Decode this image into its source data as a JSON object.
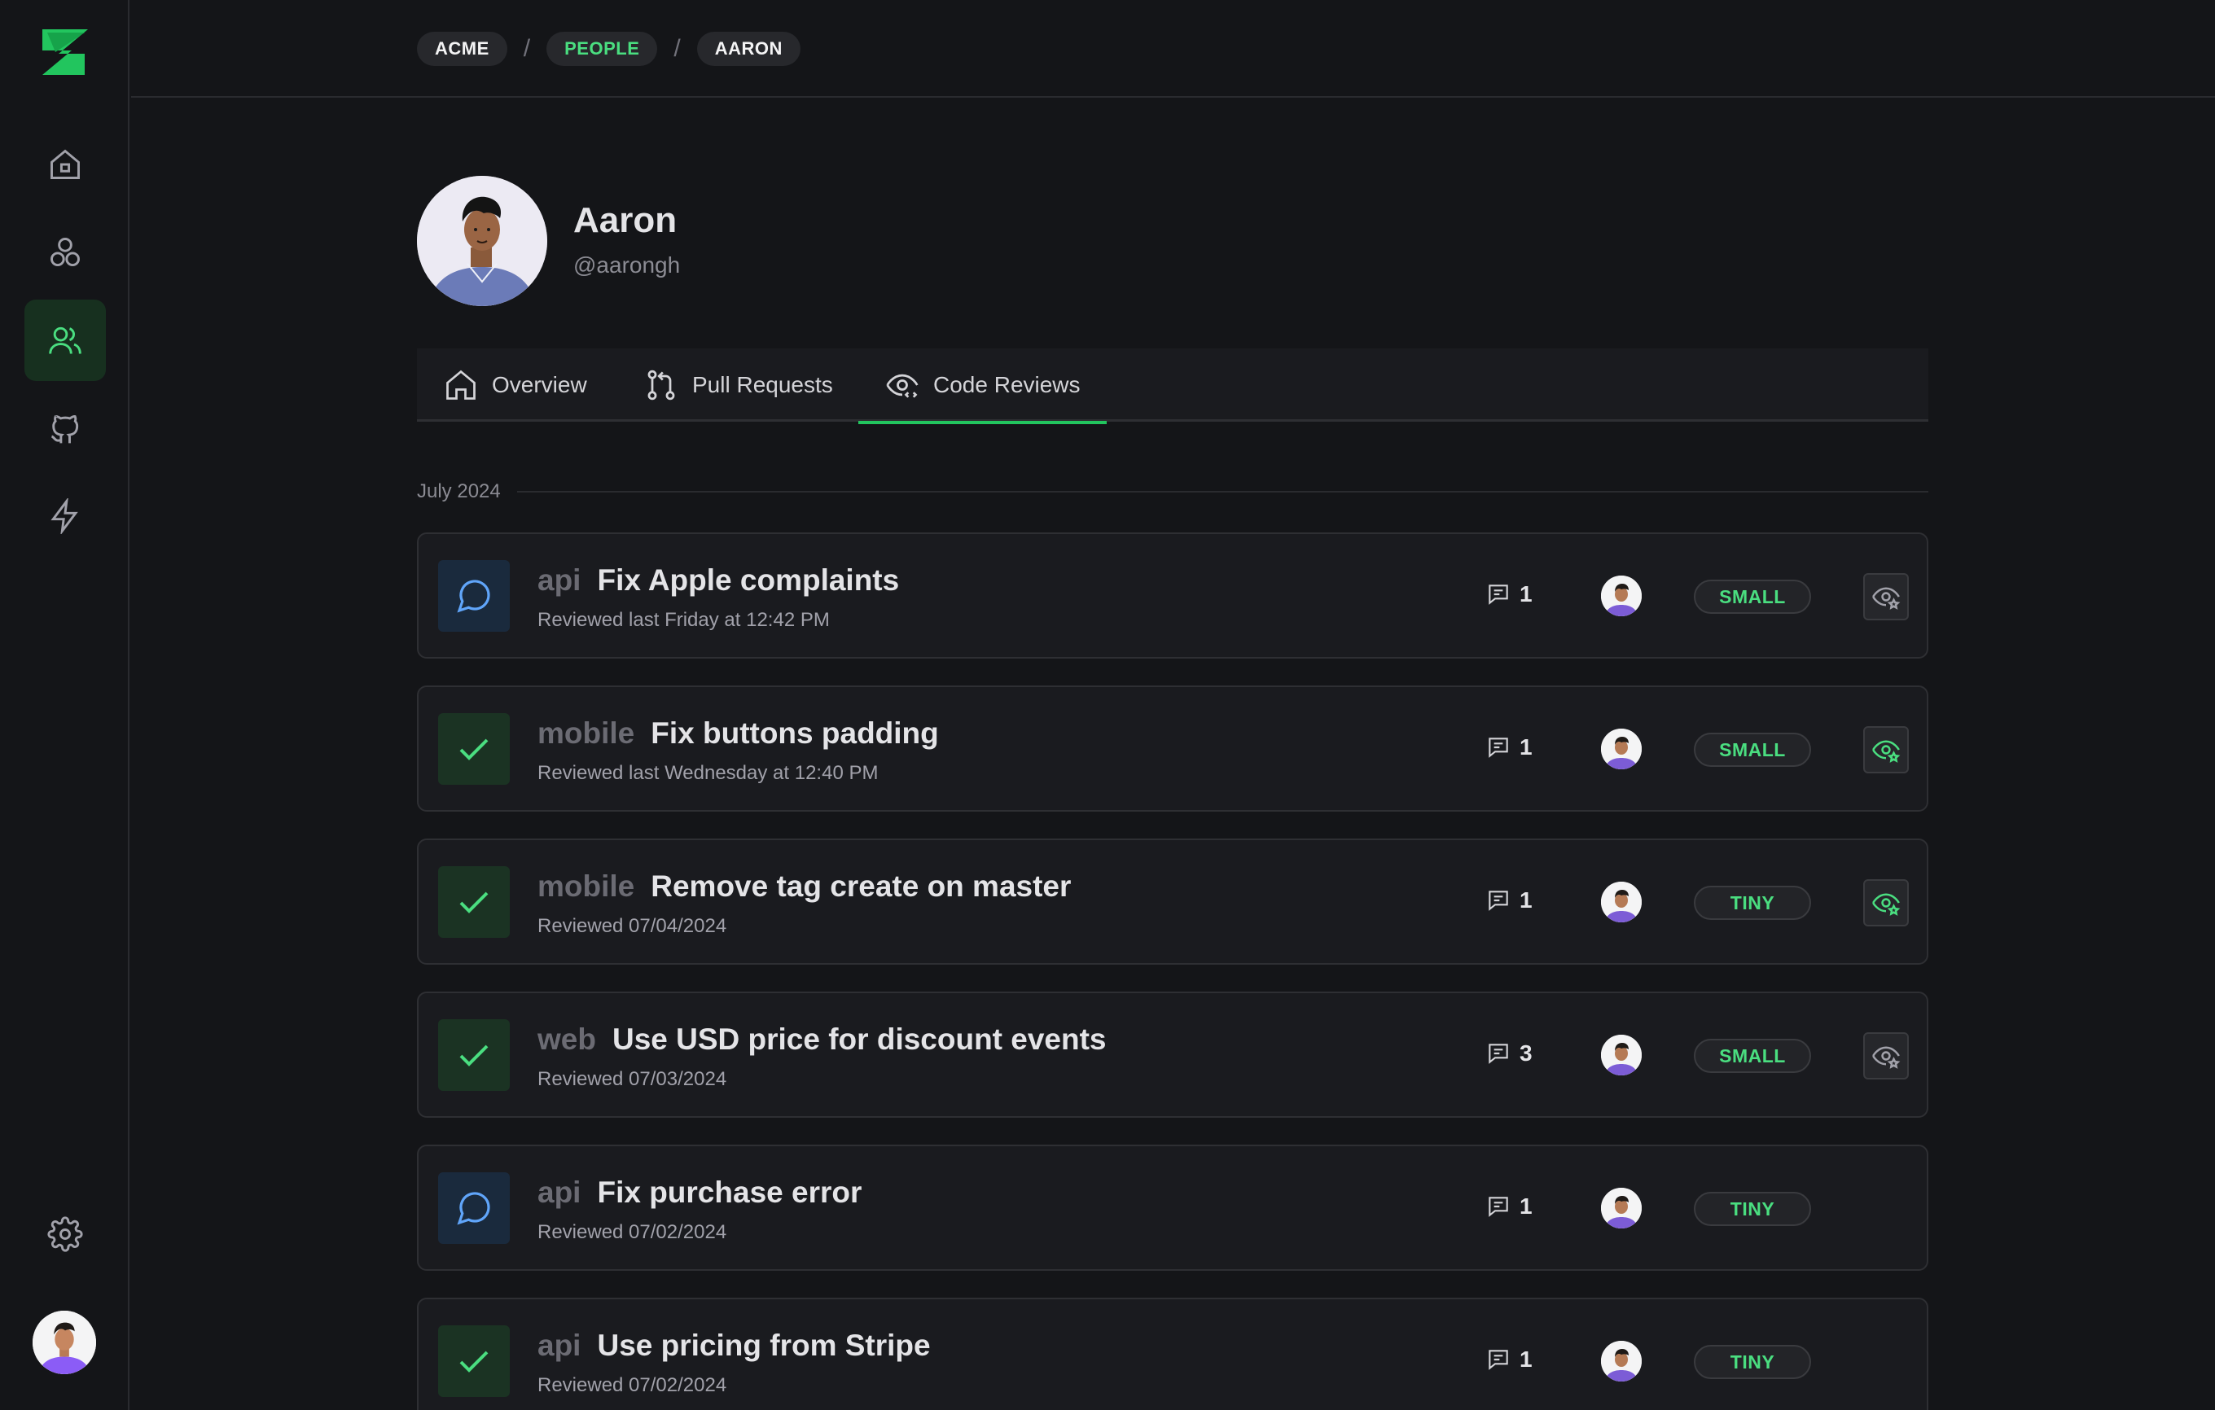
{
  "breadcrumb": [
    "ACME",
    "PEOPLE",
    "AARON"
  ],
  "breadcrumb_separator": "/",
  "profile": {
    "name": "Aaron",
    "handle": "@aarongh"
  },
  "tabs": [
    {
      "label": "Overview",
      "icon": "home-icon"
    },
    {
      "label": "Pull Requests",
      "icon": "git-pull-request-icon"
    },
    {
      "label": "Code Reviews",
      "icon": "eye-code-icon",
      "active": true
    }
  ],
  "month_label": "July 2024",
  "reviews": [
    {
      "status": "commented",
      "repo": "api",
      "title": "Fix Apple complaints",
      "subtitle": "Reviewed last Friday at 12:42 PM",
      "comments": "1",
      "size": "SMALL",
      "watch": "inactive"
    },
    {
      "status": "approved",
      "repo": "mobile",
      "title": "Fix buttons padding",
      "subtitle": "Reviewed last Wednesday at 12:40 PM",
      "comments": "1",
      "size": "SMALL",
      "watch": "active"
    },
    {
      "status": "approved",
      "repo": "mobile",
      "title": "Remove tag create on master",
      "subtitle": "Reviewed 07/04/2024",
      "comments": "1",
      "size": "TINY",
      "watch": "active"
    },
    {
      "status": "approved",
      "repo": "web",
      "title": "Use USD price for discount events",
      "subtitle": "Reviewed 07/03/2024",
      "comments": "3",
      "size": "SMALL",
      "watch": "inactive"
    },
    {
      "status": "commented",
      "repo": "api",
      "title": "Fix purchase error",
      "subtitle": "Reviewed 07/02/2024",
      "comments": "1",
      "size": "TINY",
      "watch": "none"
    },
    {
      "status": "approved",
      "repo": "api",
      "title": "Use pricing from Stripe",
      "subtitle": "Reviewed 07/02/2024",
      "comments": "1",
      "size": "TINY",
      "watch": "none"
    }
  ],
  "colors": {
    "accent": "#22c55e",
    "background": "#141518",
    "card": "#1a1b1f",
    "comment_blue": "#60a5fa"
  }
}
